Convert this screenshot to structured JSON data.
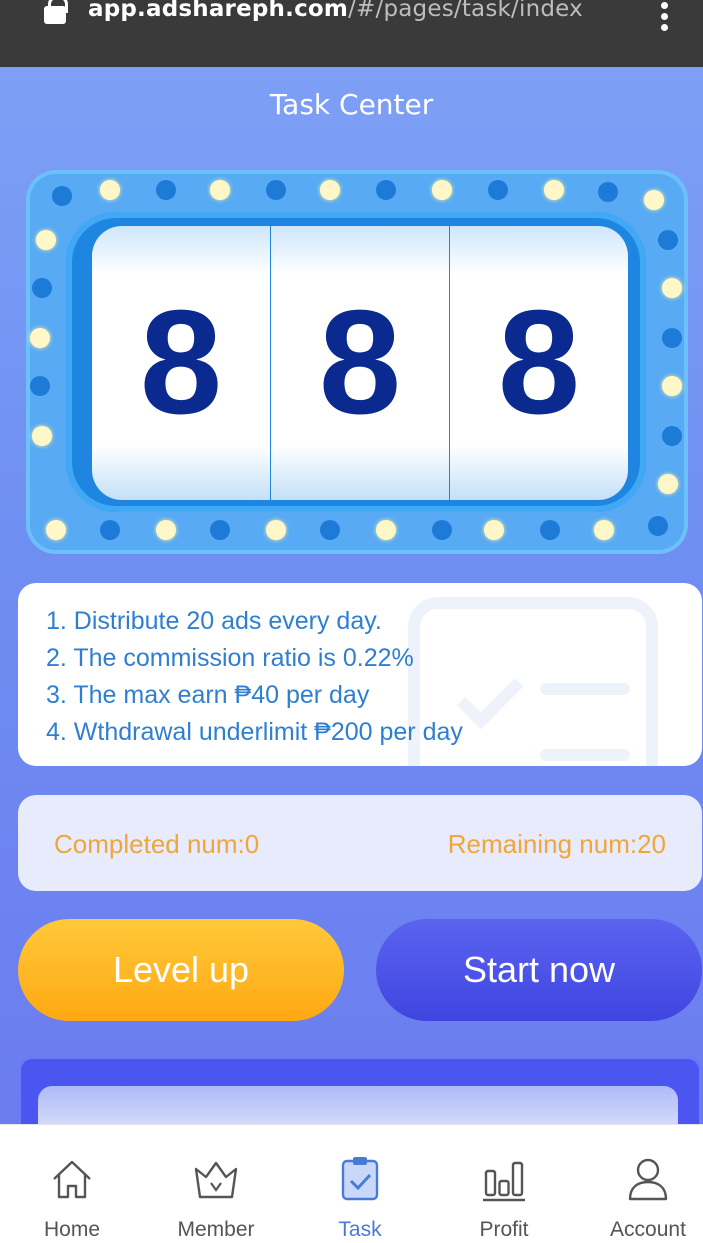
{
  "browser": {
    "url_host": "app.adshareph.com",
    "url_path": "/#/pages/task/index"
  },
  "page": {
    "title": "Task Center"
  },
  "slot": {
    "reels": [
      "8",
      "8",
      "8"
    ]
  },
  "rules": [
    "1. Distribute 20 ads every day.",
    "2. The commission ratio is 0.22%",
    "3. The max earn ₱40 per day",
    "4. Wthdrawal underlimit ₱200 per day"
  ],
  "counts": {
    "completed": "Completed num:0",
    "remaining": "Remaining num:20"
  },
  "buttons": {
    "level_up": "Level up",
    "start_now": "Start now"
  },
  "tabbar": {
    "items": [
      {
        "label": "Home",
        "icon": "home-icon"
      },
      {
        "label": "Member",
        "icon": "crown-icon"
      },
      {
        "label": "Task",
        "icon": "clipboard-check-icon",
        "active": true
      },
      {
        "label": "Profit",
        "icon": "bar-chart-icon"
      },
      {
        "label": "Account",
        "icon": "user-icon"
      }
    ]
  },
  "colors": {
    "accent": "#4a7ad8",
    "rule_text": "#2f7fd1",
    "count_text": "#f0a63a",
    "level_button": "#ffb31e",
    "start_button": "#4b50e6",
    "reel_digit": "#0a2a8f"
  }
}
